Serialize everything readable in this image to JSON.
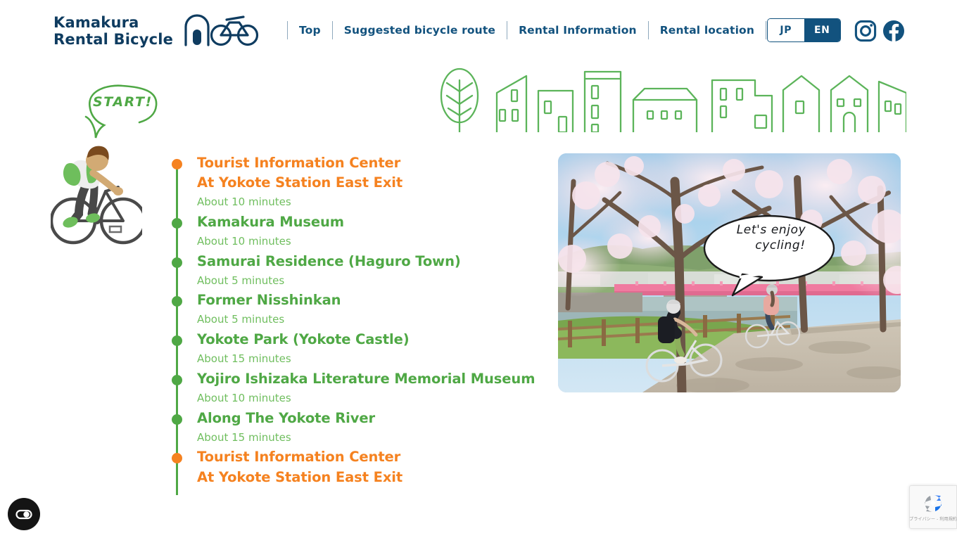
{
  "header": {
    "logo": {
      "line1": "Kamakura",
      "line2": "Rental  Bicycle",
      "icon": "kura-bicycle-logo-icon"
    },
    "nav": [
      {
        "label": "Top"
      },
      {
        "label": "Suggested bicycle route"
      },
      {
        "label": "Rental Information"
      },
      {
        "label": "Rental location"
      }
    ],
    "language": {
      "jp": "JP",
      "en": "EN",
      "active": "EN"
    },
    "social": [
      {
        "name": "instagram-icon"
      },
      {
        "name": "facebook-icon"
      }
    ]
  },
  "hero": {
    "start_label": "START!",
    "townscape_icon": "green-townscape-illustration",
    "cyclist_icon": "cyclist-illustration"
  },
  "route": {
    "stops": [
      {
        "title": "Tourist Information Center\nAt Yokote Station East Exit",
        "title_line1": "Tourist Information Center",
        "title_line2": "At Yokote Station East Exit",
        "color": "orange",
        "duration": "About 10 minutes"
      },
      {
        "title": "Kamakura Museum",
        "color": "green",
        "duration": "About 10 minutes"
      },
      {
        "title": "Samurai Residence (Haguro Town)",
        "color": "green",
        "duration": "About 5 minutes"
      },
      {
        "title": "Former Nisshinkan",
        "color": "green",
        "duration": "About 5 minutes"
      },
      {
        "title": "Yokote Park (Yokote Castle)",
        "color": "green",
        "duration": "About 15 minutes"
      },
      {
        "title": "Yojiro Ishizaka Literature Memorial Museum",
        "color": "green",
        "duration": "About 10 minutes"
      },
      {
        "title": "Along The Yokote River",
        "color": "green",
        "duration": "About 15 minutes"
      },
      {
        "title": "Tourist Information Center\nAt Yokote Station East Exit",
        "title_line1": "Tourist Information Center",
        "title_line2": "At Yokote Station East Exit",
        "color": "orange",
        "duration": ""
      }
    ]
  },
  "photo": {
    "alt": "cyclists-under-cherry-blossoms-photo",
    "bubble_line1": "Let's enjoy",
    "bubble_line2": "cycling!"
  },
  "widgets": {
    "accessibility_label": "accessibility-widget",
    "recaptcha_text": "プライバシー - 利用規約"
  },
  "colors": {
    "navy": "#12527E",
    "logo_navy": "#0F3C60",
    "orange": "#F58220",
    "green": "#4FA845",
    "light_green": "#6FBE5E"
  }
}
